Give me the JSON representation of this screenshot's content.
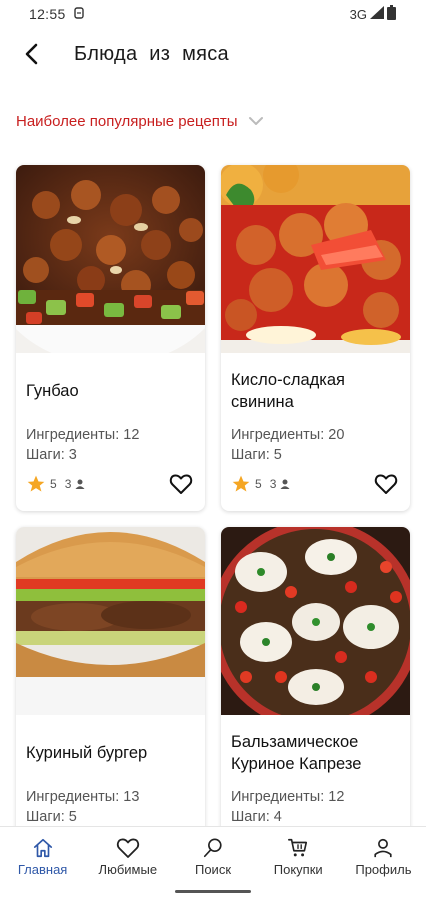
{
  "status": {
    "time": "12:55",
    "network": "3G"
  },
  "header": {
    "title": "Блюда из мяса"
  },
  "filter": {
    "label": "Наиболее популярные рецепты"
  },
  "cards": [
    {
      "title": "Гунбао",
      "ingredients": "Ингредиенты: 12",
      "steps": "Шаги: 3",
      "rating": "5",
      "count": "3"
    },
    {
      "title": "Кисло-сладкая свинина",
      "ingredients": "Ингредиенты: 20",
      "steps": "Шаги: 5",
      "rating": "5",
      "count": "3"
    },
    {
      "title": "Куриный бургер",
      "ingredients": "Ингредиенты: 13",
      "steps": "Шаги: 5"
    },
    {
      "title": "Бальзамическое Куриное Капрезе",
      "ingredients": "Ингредиенты: 12",
      "steps": "Шаги: 4"
    }
  ],
  "nav": {
    "items": [
      {
        "label": "Главная",
        "icon": "home-icon",
        "active": true
      },
      {
        "label": "Любимые",
        "icon": "heart-icon"
      },
      {
        "label": "Поиск",
        "icon": "search-icon"
      },
      {
        "label": "Покупки",
        "icon": "cart-icon"
      },
      {
        "label": "Профиль",
        "icon": "profile-icon"
      }
    ]
  },
  "colors": {
    "accent_red": "#c81f1f",
    "nav_active": "#2f58a8",
    "star": "#f5a623"
  }
}
